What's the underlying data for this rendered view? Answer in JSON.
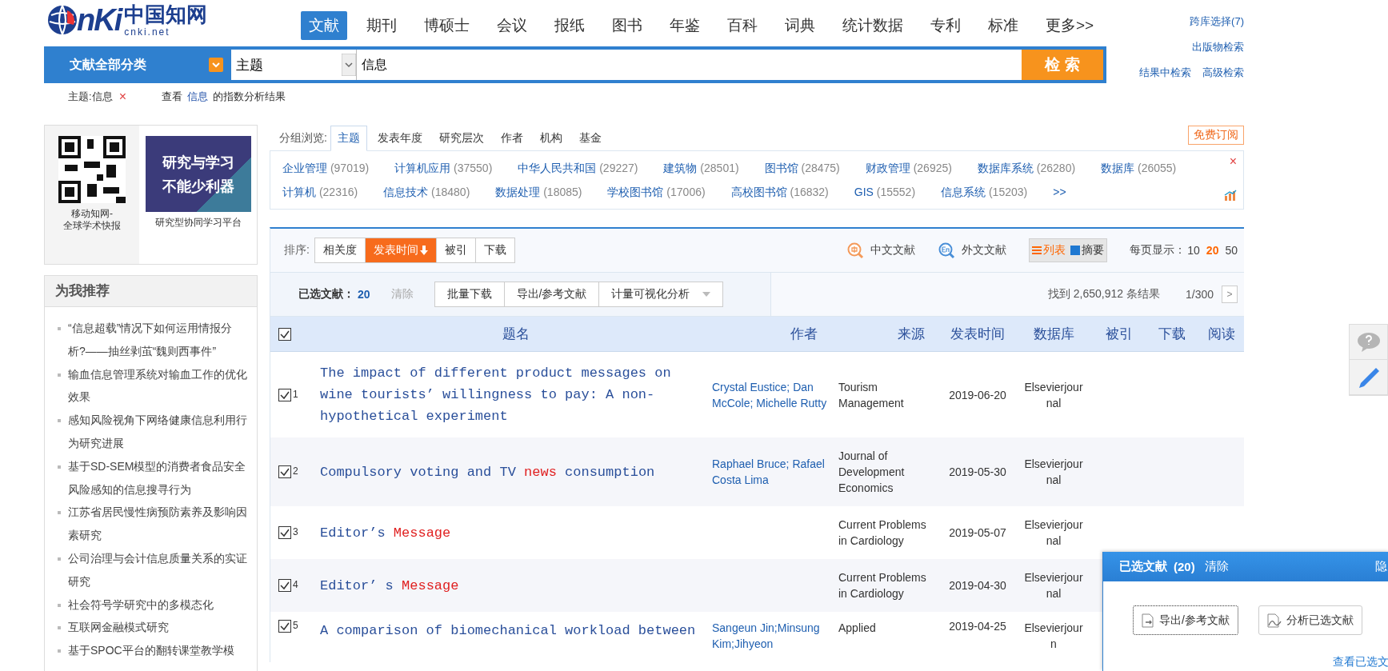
{
  "logo": {
    "mark": "nKi",
    "name": "中国知网",
    "domain": "cnki.net"
  },
  "nav": [
    {
      "label": "文献",
      "selected": true
    },
    {
      "label": "期刊",
      "selected": false
    },
    {
      "label": "博硕士",
      "selected": false
    },
    {
      "label": "会议",
      "selected": false
    },
    {
      "label": "报纸",
      "selected": false
    },
    {
      "label": "图书",
      "selected": false
    },
    {
      "label": "年鉴",
      "selected": false
    },
    {
      "label": "百科",
      "selected": false
    },
    {
      "label": "词典",
      "selected": false
    },
    {
      "label": "统计数据",
      "selected": false
    },
    {
      "label": "专利",
      "selected": false
    },
    {
      "label": "标准",
      "selected": false
    },
    {
      "label": "更多>>",
      "selected": false
    }
  ],
  "header_links": [
    "跨库选择(7)",
    "出版物检索",
    "结果中检索",
    "高级检索"
  ],
  "search": {
    "category": "文献全部分类",
    "field": "主题",
    "value": "信息",
    "button": "检 索"
  },
  "filter": {
    "tag": "主题:信息",
    "close": "×",
    "pre": "查看",
    "keyword": "信息",
    "post": "的指数分析结果"
  },
  "ads": {
    "qr_caption": "移动知网-\n全球学术快报",
    "banner": [
      "研究与学习",
      "不能少利器"
    ],
    "banner_caption": "研究型协同学习平台"
  },
  "recommend": {
    "title": "为我推荐",
    "items": [
      "“信息超载”情况下如何运用情报分析?——抽丝剥茧“魏则西事件”",
      "输血信息管理系统对输血工作的优化效果",
      "感知风险视角下网络健康信息利用行为研究进展",
      "基于SD-SEM模型的消费者食品安全风险感知的信息搜寻行为",
      "江苏省居民慢性病预防素养及影响因素研究",
      "公司治理与会计信息质量关系的实证研究",
      "社会符号学研究中的多模态化",
      "互联网金融模式研究",
      "基于SPOC平台的翻转课堂教学模"
    ]
  },
  "group_browse": {
    "label": "分组浏览:",
    "tabs": [
      {
        "label": "主题",
        "selected": true
      },
      {
        "label": "发表年度",
        "selected": false
      },
      {
        "label": "研究层次",
        "selected": false
      },
      {
        "label": "作者",
        "selected": false
      },
      {
        "label": "机构",
        "selected": false
      },
      {
        "label": "基金",
        "selected": false
      }
    ],
    "subscribe": "免费订阅",
    "facets": [
      {
        "name": "企业管理",
        "count": "(97019)"
      },
      {
        "name": "计算机应用",
        "count": "(37550)"
      },
      {
        "name": "中华人民共和国",
        "count": "(29227)"
      },
      {
        "name": "建筑物",
        "count": "(28501)"
      },
      {
        "name": "图书馆",
        "count": "(28475)"
      },
      {
        "name": "财政管理",
        "count": "(26925)"
      },
      {
        "name": "数据库系统",
        "count": "(26280)"
      },
      {
        "name": "数据库",
        "count": "(26055)"
      },
      {
        "name": "计算机",
        "count": "(22316)"
      },
      {
        "name": "信息技术",
        "count": "(18480)"
      },
      {
        "name": "数据处理",
        "count": "(18085)"
      },
      {
        "name": "学校图书馆",
        "count": "(17006)"
      },
      {
        "name": "高校图书馆",
        "count": "(16832)"
      },
      {
        "name": "GIS",
        "count": "(15552)"
      },
      {
        "name": "信息系统",
        "count": "(15203)"
      }
    ],
    "more": ">>",
    "close": "×"
  },
  "sort": {
    "label": "排序:",
    "options": [
      {
        "label": "相关度",
        "selected": false
      },
      {
        "label": "发表时间",
        "selected": true
      },
      {
        "label": "被引",
        "selected": false
      },
      {
        "label": "下载",
        "selected": false
      }
    ],
    "languages": [
      "中文文献",
      "外文文献"
    ],
    "views": [
      {
        "label": "列表",
        "selected": true
      },
      {
        "label": "摘要",
        "selected": false
      }
    ],
    "per_page_label": "每页显示：",
    "per_page": [
      {
        "label": "10",
        "selected": false
      },
      {
        "label": "20",
        "selected": true
      },
      {
        "label": "50",
        "selected": false
      }
    ]
  },
  "selection": {
    "label": "已选文献：",
    "count": "20",
    "clear": "清除",
    "actions": [
      "批量下载",
      "导出/参考文献",
      "计量可视化分析"
    ],
    "found": "找到 2,650,912 条结果",
    "page": "1/300",
    "next": ">"
  },
  "table": {
    "all_checked": true,
    "columns": [
      "题名",
      "作者",
      "来源",
      "发表时间",
      "数据库",
      "被引",
      "下载",
      "阅读"
    ],
    "rows": [
      {
        "index": "1",
        "checked": true,
        "title": [
          {
            "text": "The impact of different product messages on wine tourists’ willingness to pay: A non-hypothetical experiment",
            "hit": false
          }
        ],
        "authors": "Crystal Eustice; Dan McCole; Michelle Rutty",
        "source": "Tourism Management",
        "date": "2019-06-20",
        "database": "Elsevierjournal"
      },
      {
        "index": "2",
        "checked": true,
        "title": [
          {
            "text": "Compulsory voting and TV ",
            "hit": false
          },
          {
            "text": "news",
            "hit": true
          },
          {
            "text": " consumption",
            "hit": false
          }
        ],
        "authors": "Raphael Bruce; Rafael Costa Lima",
        "source": "Journal of Development Economics",
        "date": "2019-05-30",
        "database": "Elsevierjournal"
      },
      {
        "index": "3",
        "checked": true,
        "title": [
          {
            "text": "Editor’s ",
            "hit": false
          },
          {
            "text": "Message",
            "hit": true
          }
        ],
        "authors": "",
        "source": "Current Problems in Cardiology",
        "date": "2019-05-07",
        "database": "Elsevierjournal"
      },
      {
        "index": "4",
        "checked": true,
        "title": [
          {
            "text": "Editor’ s ",
            "hit": false
          },
          {
            "text": "Message",
            "hit": true
          }
        ],
        "authors": "",
        "source": "Current Problems in Cardiology",
        "date": "2019-04-30",
        "database": "Elsevierjournal"
      },
      {
        "index": "5",
        "checked": true,
        "title": [
          {
            "text": "A comparison of biomechanical workload between",
            "hit": false
          }
        ],
        "authors": "Sangeun Jin;Minsung Kim;Jihyeon",
        "source": "Applied",
        "date": "2019-04-25",
        "database": "Elsevierjourn"
      }
    ]
  },
  "popup": {
    "title": "已选文献",
    "count": "(20)",
    "clear": "清除",
    "hide": "隐",
    "buttons": [
      "导出/参考文献",
      "分析已选文献"
    ],
    "link": "查看已选文"
  }
}
